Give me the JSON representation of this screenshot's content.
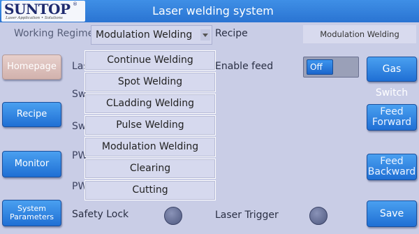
{
  "header": {
    "logo_text": "SUNTOP",
    "logo_reg": "®",
    "logo_tagline": "Laser Application • Solutions",
    "title": "Laser welding system"
  },
  "top_row": {
    "working_regime_label": "Working Regime",
    "working_regime_value": "Modulation Welding",
    "recipe_label": "Recipe",
    "recipe_value": "Modulation Welding"
  },
  "regime_options": [
    "Continue Welding",
    "Spot Welding",
    "CLadding Welding",
    "Pulse Welding",
    "Modulation Welding",
    "Clearing",
    "Cutting"
  ],
  "hidden_labels": {
    "row1": "Las",
    "row2": "Sw",
    "row3": "Sw",
    "row4": "PW",
    "row5": "PW"
  },
  "nav": {
    "homepage": "Homepage",
    "recipe": "Recipe",
    "monitor": "Monitor",
    "system_parameters_line1": "System",
    "system_parameters_line2": "Parameters"
  },
  "feed": {
    "enable_feed_label": "Enable feed",
    "toggle_state": "Off"
  },
  "right_buttons": {
    "gas_switch": "Gas Switch",
    "feed_forward_line1": "Feed",
    "feed_forward_line2": "Forward",
    "feed_backward_line1": "Feed",
    "feed_backward_line2": "Backward",
    "save": "Save"
  },
  "bottom": {
    "safety_lock_label": "Safety Lock",
    "laser_trigger_label": "Laser Trigger"
  },
  "colors": {
    "background": "#c9cde6",
    "header": "#2a74d2",
    "button_blue": "#1f6fd4",
    "homepage_button": "#d2b2ad"
  }
}
